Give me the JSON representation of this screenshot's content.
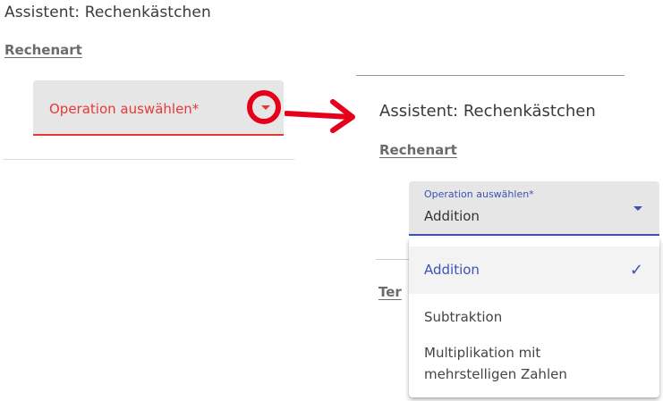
{
  "left_panel": {
    "title": "Assistent: Rechenkästchen",
    "section": "Rechenart",
    "select_label": "Operation auswählen*"
  },
  "right_panel": {
    "title": "Assistent: Rechenkästchen",
    "section": "Rechenart",
    "select_label": "Operation auswählen*",
    "select_value": "Addition",
    "partial_section": "Ter",
    "options": [
      {
        "label": "Addition",
        "selected": true
      },
      {
        "label": "Subtraktion",
        "selected": false
      },
      {
        "label": "Multiplikation mit mehrstelligen Zahlen",
        "selected": false
      }
    ]
  },
  "colors": {
    "error": "#e53935",
    "highlight_circle": "#e6001a",
    "accent": "#3f51b5",
    "field_bg": "#e6e6e6"
  },
  "icons": [
    "dropdown-arrow-icon",
    "arrow-right-icon",
    "checkmark-icon"
  ]
}
